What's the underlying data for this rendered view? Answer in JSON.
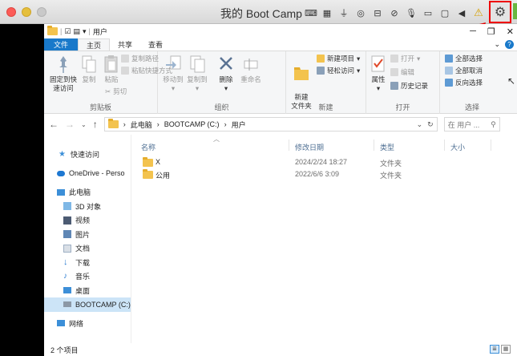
{
  "mac": {
    "title": "我的 Boot Camp",
    "toolbar_icons": [
      "keyboard-icon",
      "memory-icon",
      "usb-icon",
      "cd-icon",
      "network-icon",
      "no-video-icon",
      "mic-icon",
      "display-icon",
      "camera-icon",
      "sound-icon",
      "warning-icon"
    ],
    "highlight_color": "#e00000"
  },
  "explorer": {
    "title": "用户",
    "tabs": [
      "文件",
      "主页",
      "共享",
      "查看"
    ],
    "active_tab": "主页",
    "window_controls": [
      "minimize",
      "restore",
      "close"
    ],
    "ribbon": {
      "clipboard": {
        "label": "剪贴板",
        "pin": "固定到快\n速访问",
        "copy": "复制",
        "paste": "粘贴",
        "copy_path": "复制路径",
        "paste_shortcut": "粘贴快捷方式",
        "cut": "剪切"
      },
      "organize": {
        "label": "组织",
        "move_to": "移动到",
        "copy_to": "复制到",
        "delete": "删除",
        "rename": "重命名"
      },
      "new": {
        "label": "新建",
        "new_folder": "新建\n文件夹",
        "new_item": "新建项目",
        "easy_access": "轻松访问"
      },
      "open": {
        "label": "打开",
        "properties": "属性",
        "open": "打开",
        "edit": "编辑",
        "history": "历史记录"
      },
      "select": {
        "label": "选择",
        "select_all": "全部选择",
        "select_none": "全部取消",
        "invert": "反向选择"
      }
    },
    "address": {
      "parts": [
        "此电脑",
        "BOOTCAMP (C:)",
        "用户"
      ],
      "search_placeholder": "在 用户 ..."
    },
    "nav_pane": [
      {
        "label": "快速访问",
        "icon": "star-icon",
        "level": 1
      },
      {
        "label": "OneDrive - Perso",
        "icon": "cloud-icon",
        "level": 1
      },
      {
        "label": "此电脑",
        "icon": "computer-icon",
        "level": 1
      },
      {
        "label": "3D 对象",
        "icon": "cube-icon",
        "level": 2
      },
      {
        "label": "视频",
        "icon": "video-icon",
        "level": 2
      },
      {
        "label": "图片",
        "icon": "picture-icon",
        "level": 2
      },
      {
        "label": "文档",
        "icon": "document-icon",
        "level": 2
      },
      {
        "label": "下载",
        "icon": "download-icon",
        "level": 2
      },
      {
        "label": "音乐",
        "icon": "music-icon",
        "level": 2
      },
      {
        "label": "桌面",
        "icon": "desktop-icon",
        "level": 2
      },
      {
        "label": "BOOTCAMP (C:)",
        "icon": "drive-icon",
        "level": 2,
        "selected": true
      },
      {
        "label": "网络",
        "icon": "network-icon",
        "level": 1
      }
    ],
    "columns": [
      "名称",
      "修改日期",
      "类型",
      "大小"
    ],
    "files": [
      {
        "name": "X",
        "date": "2024/2/24 18:27",
        "type": "文件夹",
        "size": ""
      },
      {
        "name": "公用",
        "date": "2022/6/6 3:09",
        "type": "文件夹",
        "size": ""
      }
    ],
    "status": "2 个项目",
    "colors": {
      "file_tab": "#1979ca",
      "folder": "#f3c34e",
      "selected": "#cce4f7"
    }
  }
}
